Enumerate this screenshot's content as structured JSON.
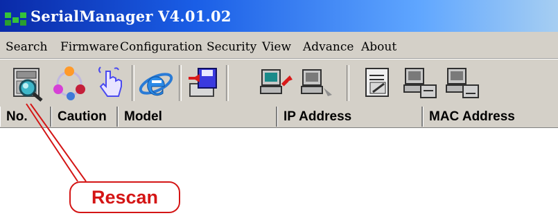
{
  "window": {
    "title": "SerialManager V4.01.02",
    "titlebar_colors": [
      "#0a2aa8",
      "#5fa6ff"
    ]
  },
  "menubar": {
    "items": [
      {
        "label": "Search"
      },
      {
        "label": "Firmware"
      },
      {
        "label": "Configuration"
      },
      {
        "label": "Security"
      },
      {
        "label": "View"
      },
      {
        "label": "Advance"
      },
      {
        "label": "About"
      }
    ]
  },
  "toolbar": {
    "buttons": [
      {
        "icon": "rescan-icon"
      },
      {
        "icon": "network-icon"
      },
      {
        "icon": "hand-pointer-icon"
      },
      {
        "icon": "internet-explorer-icon"
      },
      {
        "icon": "save-config-icon"
      },
      {
        "icon": "computer-connect-icon"
      },
      {
        "icon": "computer-disconnect-icon"
      },
      {
        "icon": "document-edit-icon"
      },
      {
        "icon": "computer-transfer-icon"
      },
      {
        "icon": "computer-transfer-2-icon"
      }
    ]
  },
  "device_list": {
    "columns": [
      "No.",
      "Caution",
      "Model",
      "IP Address",
      "MAC Address"
    ],
    "rows": []
  },
  "annotation": {
    "label": "Rescan",
    "color": "#d41515"
  }
}
